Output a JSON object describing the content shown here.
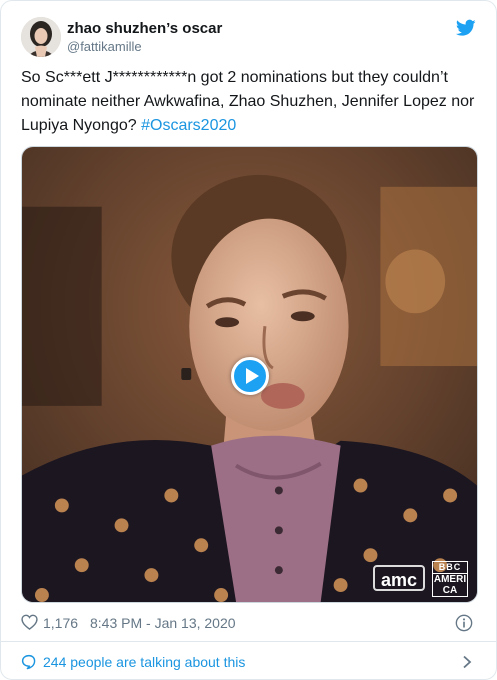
{
  "author": {
    "display_name": "zhao shuzhen’s oscar",
    "handle": "@fattikamille"
  },
  "tweet": {
    "text": "So Sc***ett J************n got 2 nominations but they couldn’t nominate neither Awkwafina, Zhao Shuzhen, Jennifer Lopez nor Lupiya Nyongo? ",
    "hashtag": "#Oscars2020"
  },
  "media": {
    "type": "video",
    "watermarks": {
      "amc": "amc",
      "bbc": "BBC",
      "america": "AMERICA"
    }
  },
  "meta": {
    "likes": "1,176",
    "timestamp": "8:43 PM - Jan 13, 2020"
  },
  "footer": {
    "talking_label": "244 people are talking about this"
  },
  "colors": {
    "accent": "#1b95e0",
    "twitter_blue": "#1da1f2",
    "muted": "#657786",
    "border": "#e1e8ed"
  }
}
